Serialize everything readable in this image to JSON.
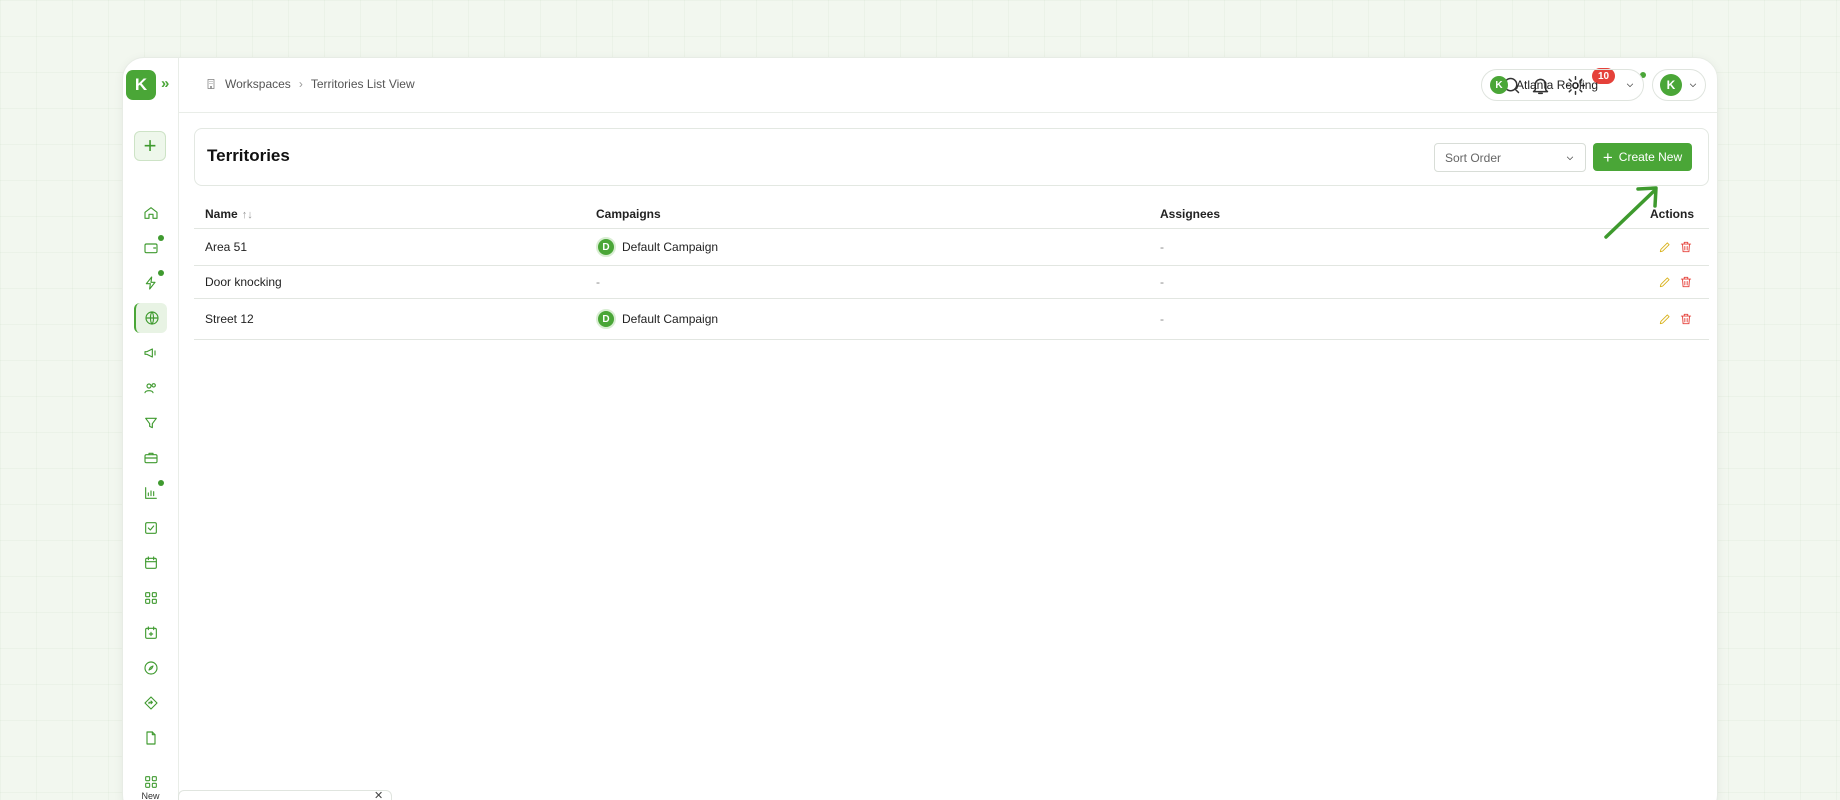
{
  "app": {
    "logo_letter": "K",
    "accent_color": "#4aa637"
  },
  "sidebar": {
    "new_label": "New",
    "items": [
      {
        "icon": "home-icon"
      },
      {
        "icon": "wallet-icon",
        "dot": true
      },
      {
        "icon": "lightning-icon",
        "dot": true
      },
      {
        "icon": "globe-icon",
        "active": true
      },
      {
        "icon": "megaphone-icon"
      },
      {
        "icon": "users-icon"
      },
      {
        "icon": "filter-icon"
      },
      {
        "icon": "briefcase-icon"
      },
      {
        "icon": "bar-chart-icon",
        "dot": true
      },
      {
        "icon": "checkbox-icon"
      },
      {
        "icon": "calendar-icon"
      },
      {
        "icon": "grid-icon"
      },
      {
        "icon": "calendar-plus-icon"
      },
      {
        "icon": "compass-icon"
      },
      {
        "icon": "directions-icon"
      },
      {
        "icon": "file-icon"
      }
    ]
  },
  "header": {
    "breadcrumb": [
      "Workspaces",
      "Territories List View"
    ],
    "notification_count": "10",
    "company_name": "Atlanta Roofing",
    "company_logo_letter": "K",
    "user_logo_letter": "K"
  },
  "page": {
    "title": "Territories",
    "sort_placeholder": "Sort Order",
    "create_label": "Create New"
  },
  "table": {
    "columns": {
      "name": "Name",
      "campaigns": "Campaigns",
      "assignees": "Assignees",
      "actions": "Actions"
    },
    "rows": [
      {
        "name": "Area 51",
        "campaign_initial": "D",
        "campaign": "Default Campaign",
        "assignees": "-"
      },
      {
        "name": "Door knocking",
        "campaign_initial": "",
        "campaign": "-",
        "assignees": "-"
      },
      {
        "name": "Street 12",
        "campaign_initial": "D",
        "campaign": "Default Campaign",
        "assignees": "-"
      }
    ]
  }
}
